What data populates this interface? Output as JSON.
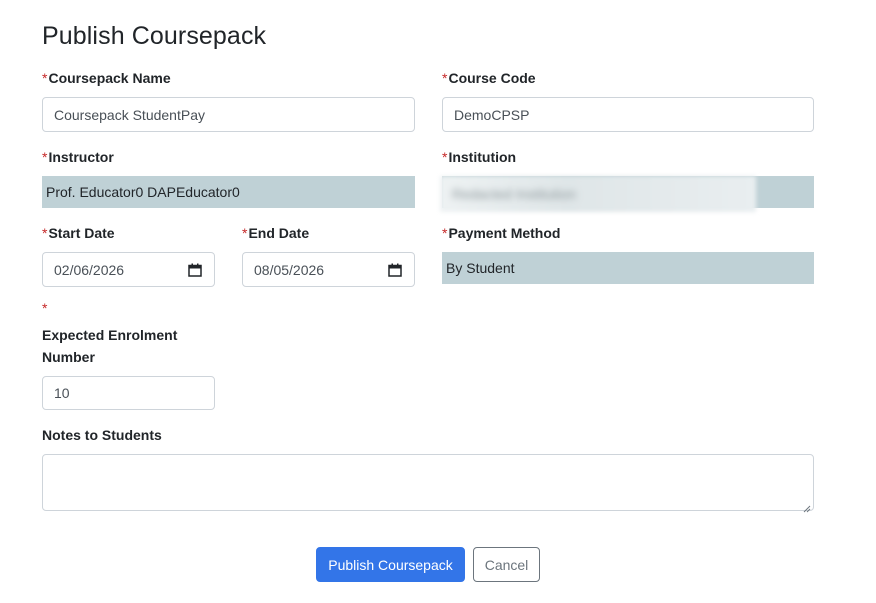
{
  "page": {
    "title": "Publish Coursepack"
  },
  "form": {
    "required_marker": "*",
    "coursepack_name": {
      "label": "Coursepack Name",
      "value": "Coursepack StudentPay"
    },
    "course_code": {
      "label": "Course Code",
      "value": "DemoCPSP"
    },
    "instructor": {
      "label": "Instructor",
      "value": "Prof. Educator0 DAPEducator0"
    },
    "institution": {
      "label": "Institution",
      "value": "Redacted Institution"
    },
    "start_date": {
      "label": "Start Date",
      "value": "02/06/2026"
    },
    "end_date": {
      "label": "End Date",
      "value": "08/05/2026"
    },
    "payment_method": {
      "label": "Payment Method",
      "value": "By Student"
    },
    "expected_enrolment": {
      "label_line1": "Expected Enrolment",
      "label_line2": "Number",
      "value": "10"
    },
    "notes": {
      "label": "Notes to Students",
      "value": ""
    }
  },
  "actions": {
    "publish_label": "Publish Coursepack",
    "cancel_label": "Cancel"
  },
  "colors": {
    "primary": "#3375e8",
    "readonly_bg": "#bfd1d6",
    "required": "#c62828"
  }
}
